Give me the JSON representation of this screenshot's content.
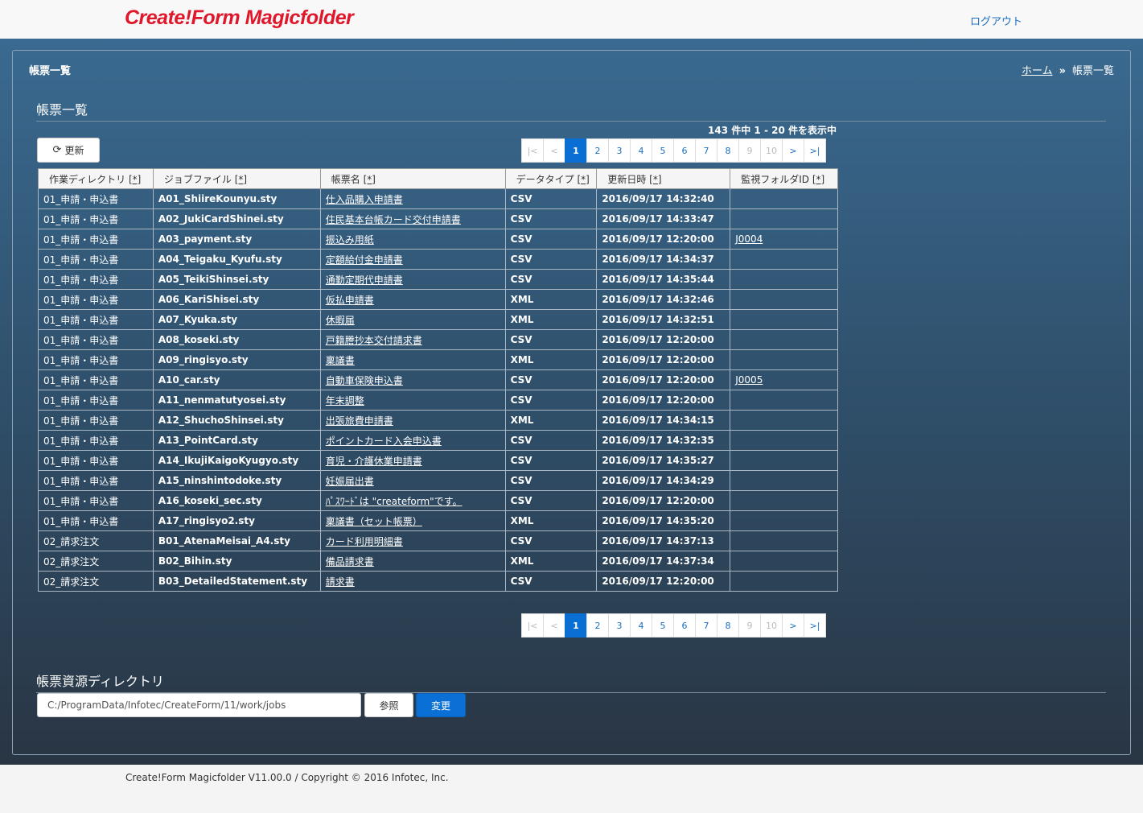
{
  "header": {
    "logo": "Create!Form Magicfolder",
    "logout": "ログアウト"
  },
  "page": {
    "title": "帳票一覧",
    "breadcrumb_home": "ホーム",
    "breadcrumb_sep": "»",
    "breadcrumb_current": "帳票一覧"
  },
  "list_section": {
    "title": "帳票一覧",
    "count": "143 件中  1 - 20 件を表示中",
    "refresh_label": "更新"
  },
  "pagination": {
    "items": [
      "|<",
      "<",
      "1",
      "2",
      "3",
      "4",
      "5",
      "6",
      "7",
      "8",
      "9",
      "10",
      ">",
      ">|"
    ],
    "active": "1",
    "disabled": [
      "|<",
      "<",
      "9",
      "10"
    ]
  },
  "table": {
    "sort_marker": "[*]",
    "columns": [
      "作業ディレクトリ",
      "ジョブファイル",
      "帳票名",
      "データタイプ",
      "更新日時",
      "監視フォルダID"
    ],
    "rows": [
      [
        "01_申請・申込書",
        "A01_ShiireKounyu.sty",
        "仕入品購入申請書",
        "CSV",
        "2016/09/17 14:32:40",
        ""
      ],
      [
        "01_申請・申込書",
        "A02_JukiCardShinei.sty",
        "住民基本台帳カード交付申請書",
        "CSV",
        "2016/09/17 14:33:47",
        ""
      ],
      [
        "01_申請・申込書",
        "A03_payment.sty",
        "振込み用紙",
        "CSV",
        "2016/09/17 12:20:00",
        "J0004"
      ],
      [
        "01_申請・申込書",
        "A04_Teigaku_Kyufu.sty",
        "定額給付金申請書",
        "CSV",
        "2016/09/17 14:34:37",
        ""
      ],
      [
        "01_申請・申込書",
        "A05_TeikiShinsei.sty",
        "通勤定期代申請書",
        "CSV",
        "2016/09/17 14:35:44",
        ""
      ],
      [
        "01_申請・申込書",
        "A06_KariShisei.sty",
        "仮払申請書",
        "XML",
        "2016/09/17 14:32:46",
        ""
      ],
      [
        "01_申請・申込書",
        "A07_Kyuka.sty",
        "休暇届",
        "XML",
        "2016/09/17 14:32:51",
        ""
      ],
      [
        "01_申請・申込書",
        "A08_koseki.sty",
        "戸籍謄抄本交付請求書",
        "CSV",
        "2016/09/17 12:20:00",
        ""
      ],
      [
        "01_申請・申込書",
        "A09_ringisyo.sty",
        "稟議書",
        "XML",
        "2016/09/17 12:20:00",
        ""
      ],
      [
        "01_申請・申込書",
        "A10_car.sty",
        "自動車保険申込書",
        "CSV",
        "2016/09/17 12:20:00",
        "J0005"
      ],
      [
        "01_申請・申込書",
        "A11_nenmatutyosei.sty",
        "年末調整",
        "CSV",
        "2016/09/17 12:20:00",
        ""
      ],
      [
        "01_申請・申込書",
        "A12_ShuchoShinsei.sty",
        "出張旅費申請書",
        "XML",
        "2016/09/17 14:34:15",
        ""
      ],
      [
        "01_申請・申込書",
        "A13_PointCard.sty",
        "ポイントカード入会申込書",
        "CSV",
        "2016/09/17 14:32:35",
        ""
      ],
      [
        "01_申請・申込書",
        "A14_IkujiKaigoKyugyo.sty",
        "育児・介護休業申請書",
        "CSV",
        "2016/09/17 14:35:27",
        ""
      ],
      [
        "01_申請・申込書",
        "A15_ninshintodoke.sty",
        "妊娠届出書",
        "CSV",
        "2016/09/17 14:34:29",
        ""
      ],
      [
        "01_申請・申込書",
        "A16_koseki_sec.sty",
        "ﾊﾟｽﾜｰﾄﾞは \"createform\"です。",
        "CSV",
        "2016/09/17 12:20:00",
        ""
      ],
      [
        "01_申請・申込書",
        "A17_ringisyo2.sty",
        "稟議書（セット帳票）",
        "XML",
        "2016/09/17 14:35:20",
        ""
      ],
      [
        "02_請求注文",
        "B01_AtenaMeisai_A4.sty",
        "カード利用明細書",
        "CSV",
        "2016/09/17 14:37:13",
        ""
      ],
      [
        "02_請求注文",
        "B02_Bihin.sty",
        "備品請求書",
        "XML",
        "2016/09/17 14:37:34",
        ""
      ],
      [
        "02_請求注文",
        "B03_DetailedStatement.sty",
        "請求書",
        "CSV",
        "2016/09/17 12:20:00",
        ""
      ]
    ]
  },
  "resource_section": {
    "title": "帳票資源ディレクトリ",
    "path_value": "C:/ProgramData/Infotec/CreateForm/11/work/jobs",
    "browse_label": "参照",
    "change_label": "変更"
  },
  "footer": {
    "copyright": "Create!Form Magicfolder V11.00.0 / Copyright © 2016 Infotec, Inc."
  }
}
